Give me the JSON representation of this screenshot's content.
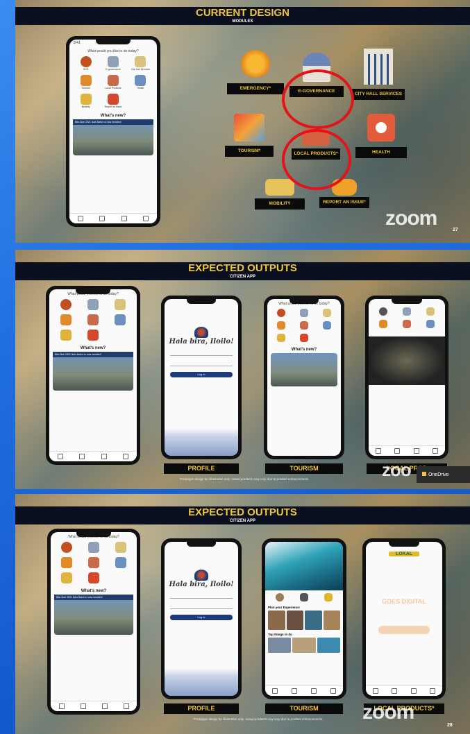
{
  "slide1": {
    "title": "CURRENT DESIGN",
    "subtitle": "MODULES",
    "zoom": "zoom",
    "page_number": "27",
    "phone": {
      "prompt": "What would you like to do today?",
      "items": [
        "SOS",
        "E-governance",
        "City Hall Services",
        "Tourism",
        "Local Products",
        "Health",
        "Mobility",
        "Report an Issue"
      ],
      "whats_new": "What's new?",
      "news_text": "Bite-Size 2021 Iloilo Batch to now enrolled!"
    },
    "modules": {
      "emergency": "EMERGENCY*",
      "egov": "E-GOVERNANCE",
      "cityhall": "CITY HALL SERVICES",
      "tourism": "TOURISM*",
      "local": "LOCAL PRODUCTS*",
      "health": "HEALTH",
      "mobility": "MOBILITY",
      "report": "REPORT AN ISSUE*"
    }
  },
  "slide2": {
    "title": "EXPECTED OUTPUTS",
    "subtitle": "CITIZEN APP",
    "captions": [
      "PROFILE",
      "TOURISM",
      "LOCAL PROD"
    ],
    "footnote": "*Prototype design for illustration only. Actual products may vary due to product enhancements.",
    "zoom": "zoo",
    "login_logo": "Hala bira, Iloilo!",
    "login_btn": "Log in"
  },
  "slide3": {
    "title": "EXPECTED OUTPUTS",
    "subtitle": "CITIZEN APP",
    "captions": [
      "PROFILE",
      "TOURISM",
      "LOCAL PRODUCTS*"
    ],
    "footnote": "*Prototype design for illustration only. Actual products may vary due to product enhancements.",
    "zoom": "zoom",
    "page_number": "28",
    "tourism_plan": "Plan your Experience",
    "tourism_top": "Top things to do",
    "local_goes": "GOES DIGITAL",
    "local_logo": "LOKAL"
  },
  "taskbar_toast": {
    "app": "OneDrive"
  }
}
